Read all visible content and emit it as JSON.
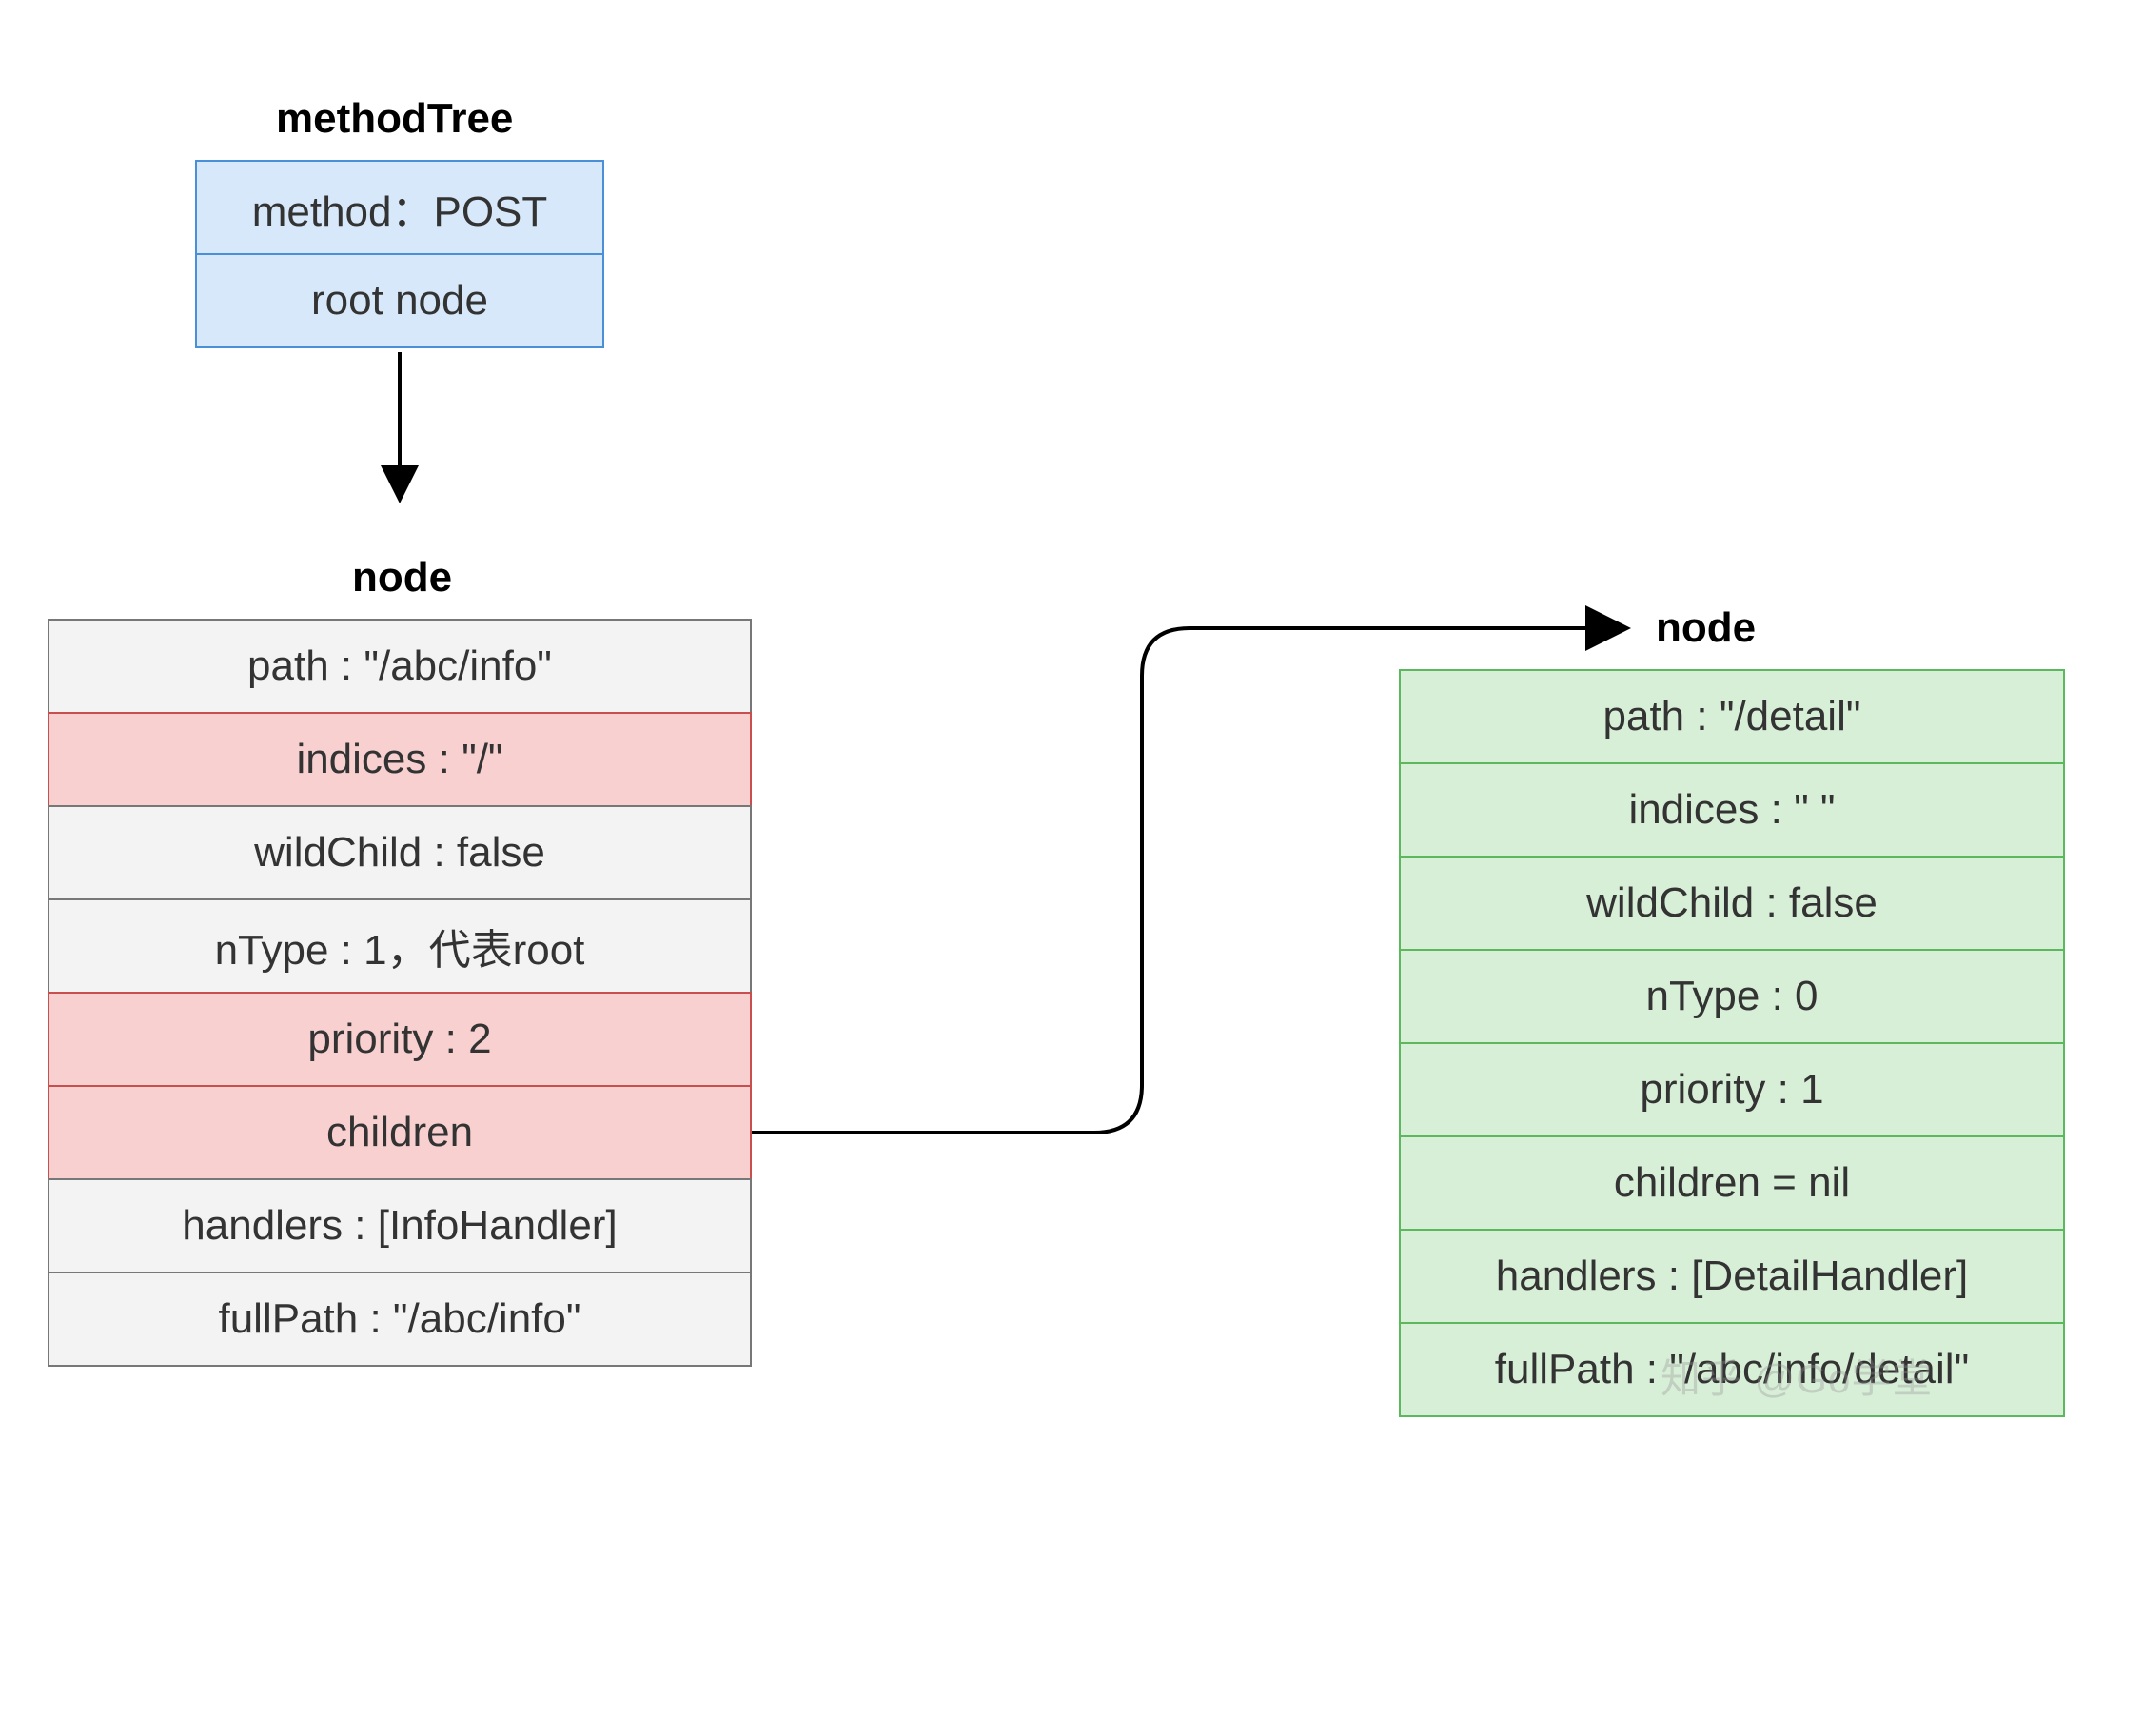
{
  "diagram": {
    "methodTree": {
      "title": "methodTree",
      "method": "method：POST",
      "root": "root node"
    },
    "nodeLeft": {
      "title": "node",
      "rows": {
        "path": "path : \"/abc/info\"",
        "indices": "indices : \"/\"",
        "wildChild": "wildChild : false",
        "nType": "nType : 1，代表root",
        "priority": "priority : 2",
        "children": "children",
        "handlers": "handlers : [InfoHandler]",
        "fullPath": "fullPath : \"/abc/info\""
      }
    },
    "nodeRight": {
      "title": "node",
      "rows": {
        "path": "path : \"/detail\"",
        "indices": "indices : \" \"",
        "wildChild": "wildChild : false",
        "nType": "nType : 0",
        "priority": "priority : 1",
        "children": "children = nil",
        "handlers": "handlers : [DetailHandler]",
        "fullPath": "fullPath : \"/abc/info/detail\""
      }
    },
    "watermark": "知乎 @Go学堂"
  }
}
